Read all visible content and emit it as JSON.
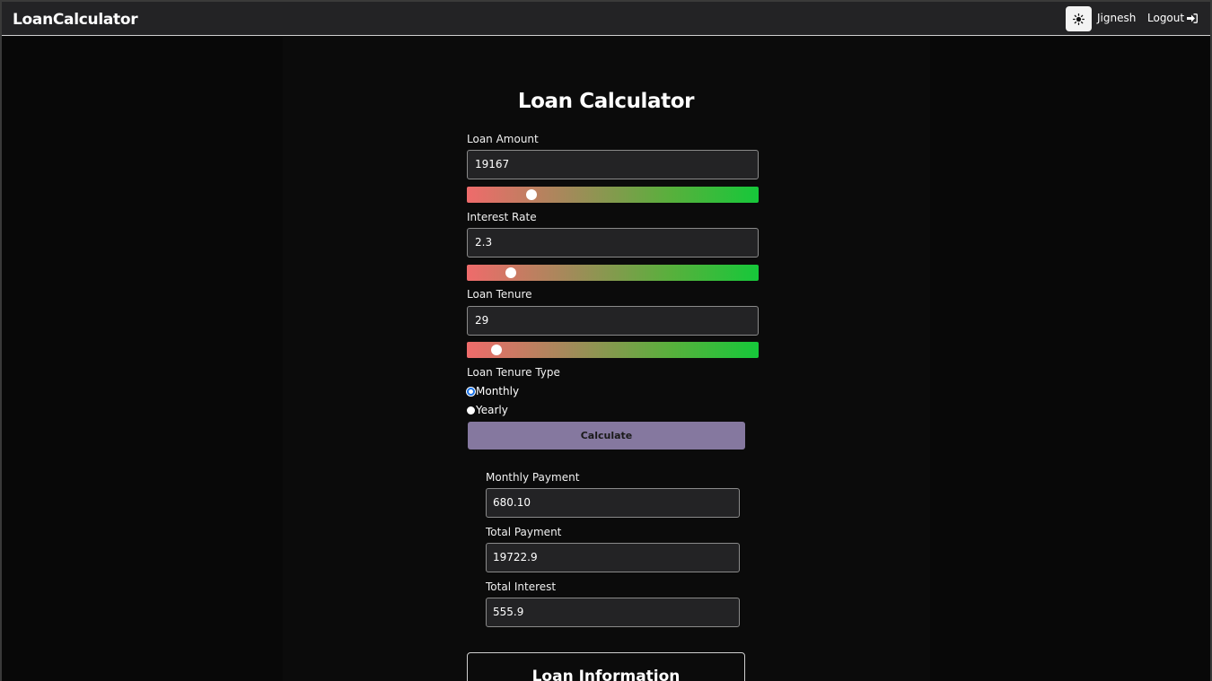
{
  "nav": {
    "brand": "LoanCalculator",
    "user": "Jignesh",
    "logout": "Logout",
    "theme_icon": "sun-icon",
    "logout_icon": "sign-out-icon"
  },
  "page": {
    "title": "Loan Calculator"
  },
  "form": {
    "loan_amount": {
      "label": "Loan Amount",
      "value": "19167",
      "slider_fraction": 0.22
    },
    "interest_rate": {
      "label": "Interest Rate",
      "value": "2.3",
      "slider_fraction": 0.15
    },
    "loan_tenure": {
      "label": "Loan Tenure",
      "value": "29",
      "slider_fraction": 0.1
    },
    "tenure_type": {
      "label": "Loan Tenure Type",
      "options": [
        "Monthly",
        "Yearly"
      ],
      "selected": "Monthly"
    },
    "calculate": "Calculate"
  },
  "results": {
    "monthly_payment": {
      "label": "Monthly Payment",
      "value": "680.10"
    },
    "total_payment": {
      "label": "Total Payment",
      "value": "19722.9"
    },
    "total_interest": {
      "label": "Total Interest",
      "value": "555.9"
    }
  },
  "info": {
    "title": "Loan Information"
  },
  "colors": {
    "button": "#85789f",
    "slider_start": "#ef6b6b",
    "slider_end": "#16c83a",
    "radio_checked": "#1a73e8"
  }
}
